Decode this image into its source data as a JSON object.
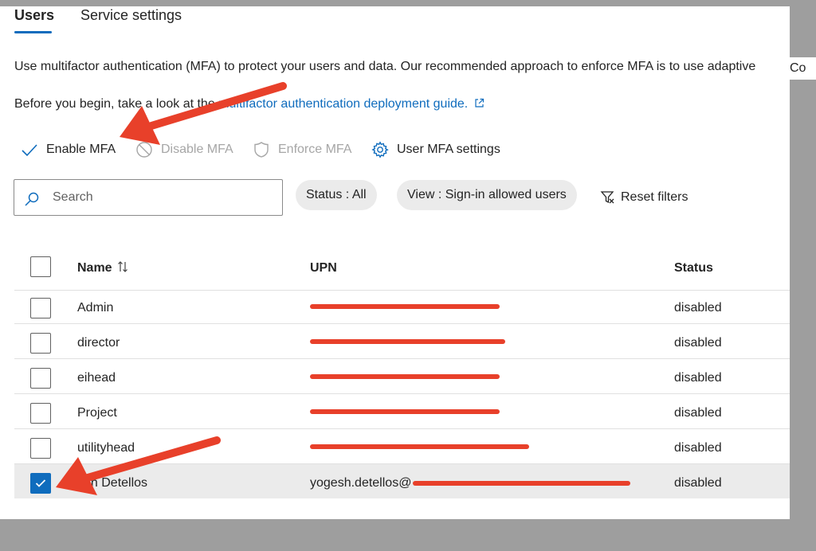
{
  "tabs": [
    {
      "label": "Users",
      "active": true
    },
    {
      "label": "Service settings",
      "active": false
    }
  ],
  "intro_text": "Use multifactor authentication (MFA) to protect your users and data. Our recommended approach to enforce MFA is to use adaptive",
  "overflow_text": "Co",
  "before_text": "Before you begin, take a look at the ",
  "guide_link": "multifactor authentication deployment guide.",
  "toolbar": {
    "enable": "Enable MFA",
    "disable": "Disable MFA",
    "enforce": "Enforce MFA",
    "settings": "User MFA settings"
  },
  "search": {
    "placeholder": "Search"
  },
  "filters": {
    "status": "Status : All",
    "view": "View : Sign-in allowed users",
    "reset": "Reset filters"
  },
  "columns": {
    "name": "Name",
    "upn": "UPN",
    "status": "Status"
  },
  "rows": [
    {
      "name": "Admin",
      "upn": "",
      "status": "disabled",
      "checked": false
    },
    {
      "name": "director",
      "upn": "",
      "status": "disabled",
      "checked": false
    },
    {
      "name": "eihead",
      "upn": "",
      "status": "disabled",
      "checked": false
    },
    {
      "name": "Project",
      "upn": "",
      "status": "disabled",
      "checked": false
    },
    {
      "name": "utilityhead",
      "upn": "",
      "status": "disabled",
      "checked": false
    },
    {
      "name": "esh Detellos",
      "upn": "yogesh.detellos@",
      "status": "disabled",
      "checked": true
    }
  ],
  "icons": {
    "enable": "checkmark-icon",
    "disable": "block-icon",
    "enforce": "shield-icon",
    "settings": "gear-icon",
    "search": "search-icon",
    "reset": "filter-reset-icon",
    "external": "external-link-icon"
  },
  "colors": {
    "accent": "#0f6cbd",
    "annotation_arrow": "#e8402a",
    "disabled_text": "#a6a6a6"
  }
}
